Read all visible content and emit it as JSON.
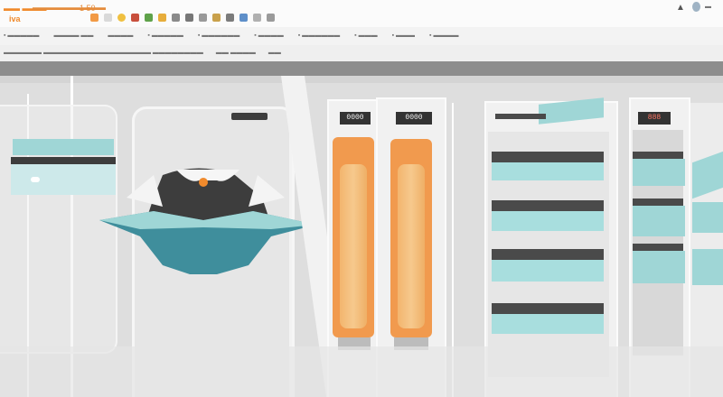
{
  "window": {
    "tab_title": "",
    "toolbar_left_label": "iva",
    "toolbar_left_label2": "1 50",
    "toolbar_center": "",
    "right_icons": [
      "warning-icon",
      "profile-icon",
      "menu-icon"
    ]
  },
  "toolbar": {
    "icons": [
      "back-icon",
      "forward-icon",
      "reload-icon",
      "home-icon",
      "star-icon",
      "tag-icon",
      "search-icon",
      "print-icon",
      "mail-icon",
      "folder-icon",
      "settings-icon",
      "chart-icon",
      "window-icon",
      "help-icon"
    ]
  },
  "bookmarks": [],
  "scene": {
    "displays": [
      {
        "name": "left-display",
        "text": "0000"
      },
      {
        "name": "right-display",
        "text": "0000"
      },
      {
        "name": "far-right-display",
        "text": "888"
      }
    ]
  },
  "colors": {
    "accent_orange": "#f08a2c",
    "teal": "#9fd6d6",
    "dark": "#3d3d3d",
    "tube": "#f6c98d"
  }
}
